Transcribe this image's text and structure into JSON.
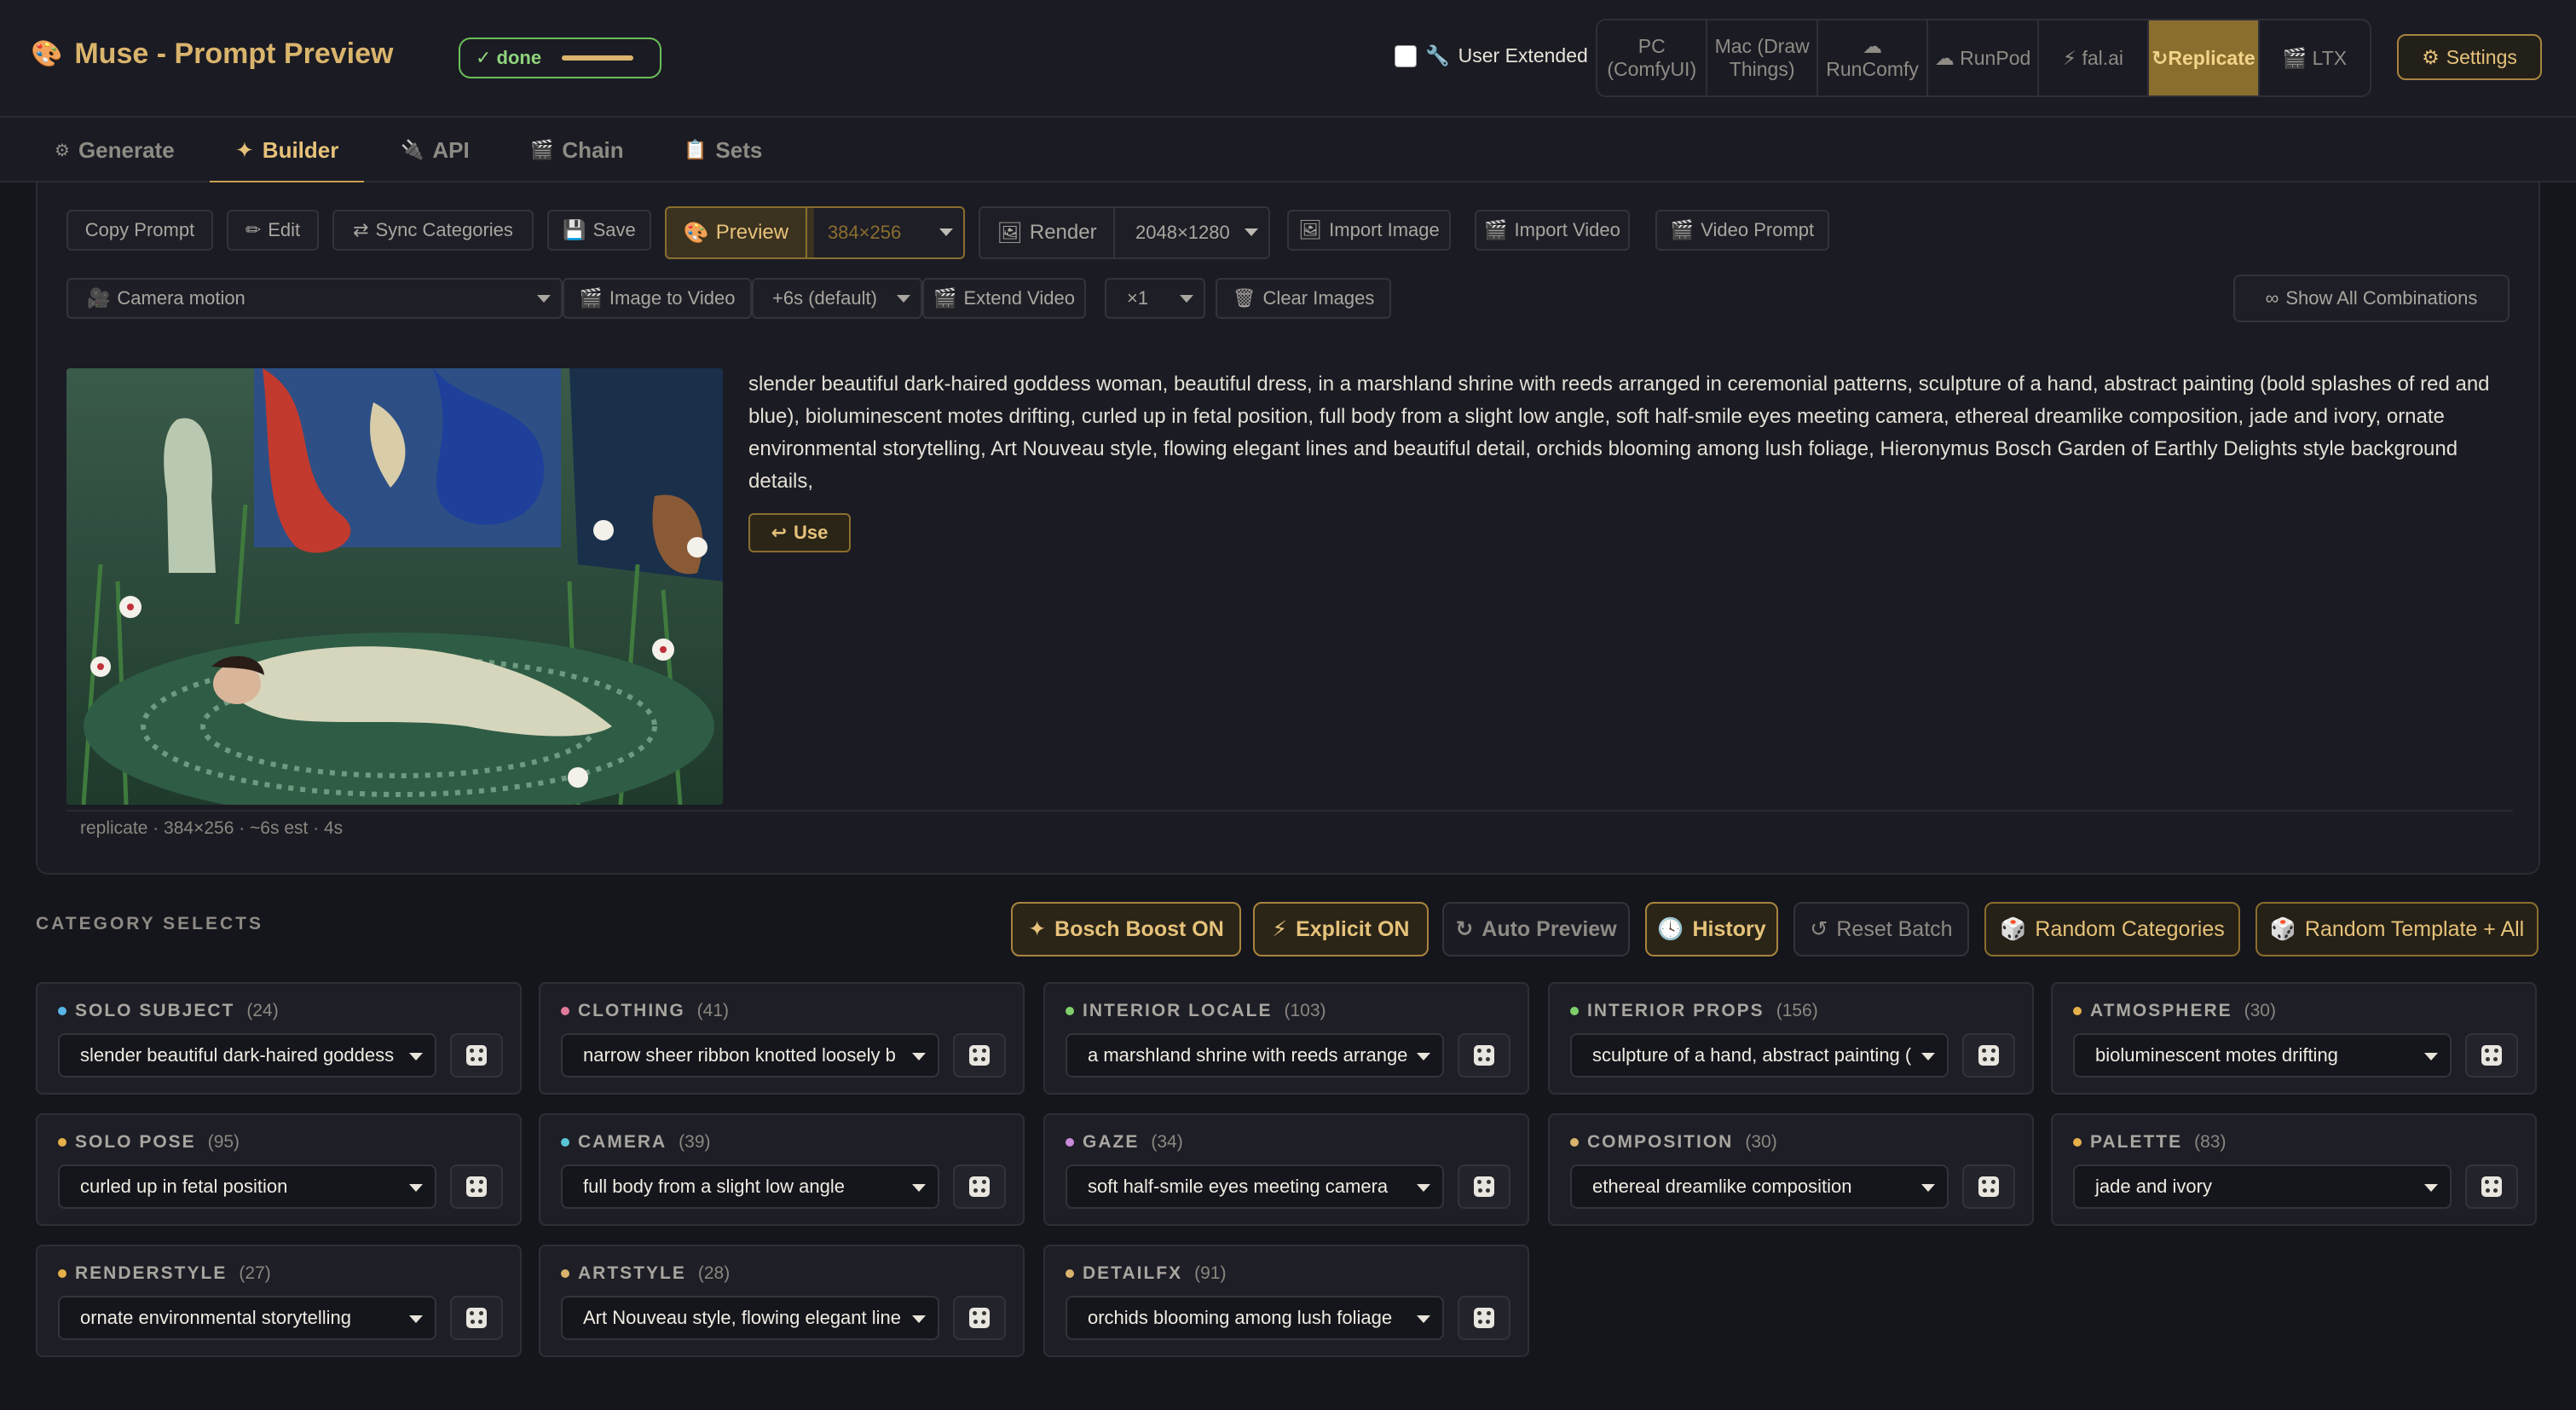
{
  "header": {
    "title": "Muse - Prompt Preview",
    "status": "✓ done",
    "user_extended_label": "User Extended",
    "backends": [
      {
        "label": "PC (ComfyUI)"
      },
      {
        "label": "Mac (Draw Things)"
      },
      {
        "label": "RunComfy"
      },
      {
        "label": "RunPod"
      },
      {
        "label": "fal.ai"
      },
      {
        "label": "Replicate",
        "active": true
      },
      {
        "label": "LTX"
      }
    ],
    "settings_label": "Settings"
  },
  "tabs": [
    {
      "label": "Generate"
    },
    {
      "label": "Builder",
      "active": true
    },
    {
      "label": "API"
    },
    {
      "label": "Chain"
    },
    {
      "label": "Sets"
    }
  ],
  "toolbar": {
    "copy_prompt": "Copy Prompt",
    "edit": "Edit",
    "sync_categories": "Sync Categories",
    "save": "Save",
    "preview": "Preview",
    "preview_size": "384×256",
    "render": "Render",
    "render_size": "2048×1280",
    "import_image": "Import Image",
    "import_video": "Import Video",
    "video_prompt": "Video Prompt",
    "camera_motion": "Camera motion",
    "image_to_video": "Image to Video",
    "duration": "+6s (default)",
    "extend_video": "Extend Video",
    "multiplier": "×1",
    "clear_images": "Clear Images",
    "show_all_combinations": "Show All Combinations"
  },
  "preview": {
    "prompt": "slender beautiful dark-haired goddess woman, beautiful dress, in a marshland shrine with reeds arranged in ceremonial patterns, sculpture of a hand, abstract painting (bold splashes of red and blue), bioluminescent motes drifting, curled up in fetal position, full body from a slight low angle, soft half-smile eyes meeting camera, ethereal dreamlike composition, jade and ivory, ornate environmental storytelling, Art Nouveau style, flowing elegant lines and beautiful detail, orchids blooming among lush foliage, Hieronymus Bosch Garden of Earthly Delights style background details,",
    "use_label": "Use",
    "meta": "replicate · 384×256 · ~6s est · 4s"
  },
  "categories_section": {
    "heading": "CATEGORY SELECTS",
    "actions": {
      "bosch_boost": "Bosch Boost ON",
      "explicit": "Explicit ON",
      "auto_preview": "Auto Preview",
      "history": "History",
      "reset_batch": "Reset Batch",
      "random_categories": "Random Categories",
      "random_template": "Random Template + All"
    },
    "cards": [
      {
        "label": "SOLO SUBJECT",
        "count": "(24)",
        "value": "slender beautiful dark-haired goddess",
        "dot": "#5bb5e8"
      },
      {
        "label": "CLOTHING",
        "count": "(41)",
        "value": "narrow sheer ribbon knotted loosely b",
        "dot": "#e07a9a"
      },
      {
        "label": "INTERIOR LOCALE",
        "count": "(103)",
        "value": "a marshland shrine with reeds arrange",
        "dot": "#7fcf6a"
      },
      {
        "label": "INTERIOR PROPS",
        "count": "(156)",
        "value": "sculpture of a hand, abstract painting (",
        "dot": "#7fcf6a"
      },
      {
        "label": "ATMOSPHERE",
        "count": "(30)",
        "value": "bioluminescent motes drifting",
        "dot": "#e6b04a"
      },
      {
        "label": "SOLO POSE",
        "count": "(95)",
        "value": "curled up in fetal position",
        "dot": "#e6b04a"
      },
      {
        "label": "CAMERA",
        "count": "(39)",
        "value": "full body from a slight low angle",
        "dot": "#5bc7d6"
      },
      {
        "label": "GAZE",
        "count": "(34)",
        "value": "soft half-smile eyes meeting camera",
        "dot": "#c98ad8"
      },
      {
        "label": "COMPOSITION",
        "count": "(30)",
        "value": "ethereal dreamlike composition",
        "dot": "#d9b46c"
      },
      {
        "label": "PALETTE",
        "count": "(83)",
        "value": "jade and ivory",
        "dot": "#e6b04a"
      },
      {
        "label": "RENDERSTYLE",
        "count": "(27)",
        "value": "ornate environmental storytelling",
        "dot": "#e6b04a"
      },
      {
        "label": "ARTSTYLE",
        "count": "(28)",
        "value": "Art Nouveau style, flowing elegant line",
        "dot": "#d9b46c"
      },
      {
        "label": "DETAILFX",
        "count": "(91)",
        "value": "orchids blooming among lush foliage",
        "dot": "#d9b46c"
      }
    ]
  },
  "colors": {
    "accent_gold": "#d9b46c",
    "status_green": "#6bbf59",
    "background": "#15151c"
  }
}
